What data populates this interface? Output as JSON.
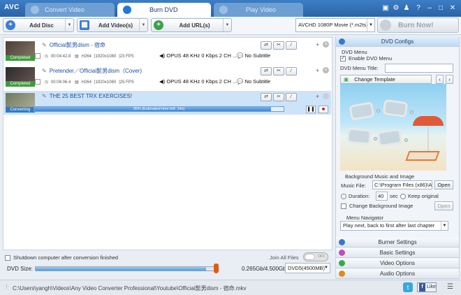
{
  "window": {
    "logo": "AVC"
  },
  "tabs": [
    {
      "label": "Convert Video",
      "color": "#9bbfe4"
    },
    {
      "label": "Burn DVD",
      "color": "#1e7ad6"
    },
    {
      "label": "Play Video",
      "color": "#9bbfe4"
    }
  ],
  "toolbar": {
    "add_disc": "Add Disc",
    "add_videos": "Add Video(s)",
    "add_urls": "Add URL(s)",
    "profile": "AVCHD 1080P Movie (*.m2ts)",
    "burn_now": "Burn Now!"
  },
  "files": [
    {
      "title": "Official髭男dism - 宿命",
      "status": "Completed",
      "duration": "00:04:42.8",
      "codec": "H264",
      "resolution": "1920x1080",
      "fps": "23 FPS",
      "audio": "OPUS 48 KHz 0 Kbps 2 CH ...",
      "subtitle": "No Subtitle"
    },
    {
      "title": "Pretender／Official髭男dism（Cover)",
      "status": "Completed",
      "duration": "00:06:06.4",
      "codec": "H264",
      "resolution": "1920x1080",
      "fps": "25 FPS",
      "audio": "OPUS 48 KHz 0 Kbps 2 CH ...",
      "subtitle": "No Subtitle"
    },
    {
      "title": "THE 25 BEST TRX EXERCISES!",
      "status": "Converting",
      "progress_text": "95% (Estimated time left: 14s)",
      "progress": 0.95
    }
  ],
  "bottom": {
    "shutdown_label": "Shutdown computer after conversion finished",
    "join_all_label": "Join All Files",
    "toggle_state": "OFF",
    "dvd_size_label": "DVD Size:",
    "dvd_size_value": "0.265Gb/4.500Gb",
    "dvd_size_fraction": 0.94,
    "dvd_type": "DVD5(4500MB)"
  },
  "panel": {
    "header": "DVD Configs",
    "dvd_menu_section": "DVD Menu",
    "enable_menu_label": "Enable DVD Menu",
    "menu_title_label": "DVD Menu Title:",
    "change_template": "Change Template",
    "bg_section": "Background Music and Image",
    "music_file_label": "Music File:",
    "music_file_value": "C:\\Program Files (x86)\\A",
    "open_label": "Open",
    "duration_label": "Duration:",
    "duration_value": "40",
    "sec_label": "sec",
    "keep_original_label": "Keep original",
    "change_bg_label": "Change Background Image",
    "nav_section": "Menu Navigator",
    "nav_value": "Play next, back to first after last chapter",
    "sections": [
      "Burner Settings",
      "Basic Settings",
      "Video Options",
      "Audio Options"
    ],
    "section_colors": [
      "#3b78c8",
      "#c44bb4",
      "#3aa84a",
      "#e08a1c"
    ]
  },
  "status": {
    "path": "C:\\Users\\yangh\\Videos\\Any Video Converter Professional\\Youtube\\Official髭男dism - 宿命.mkv",
    "like_label": "Like"
  }
}
